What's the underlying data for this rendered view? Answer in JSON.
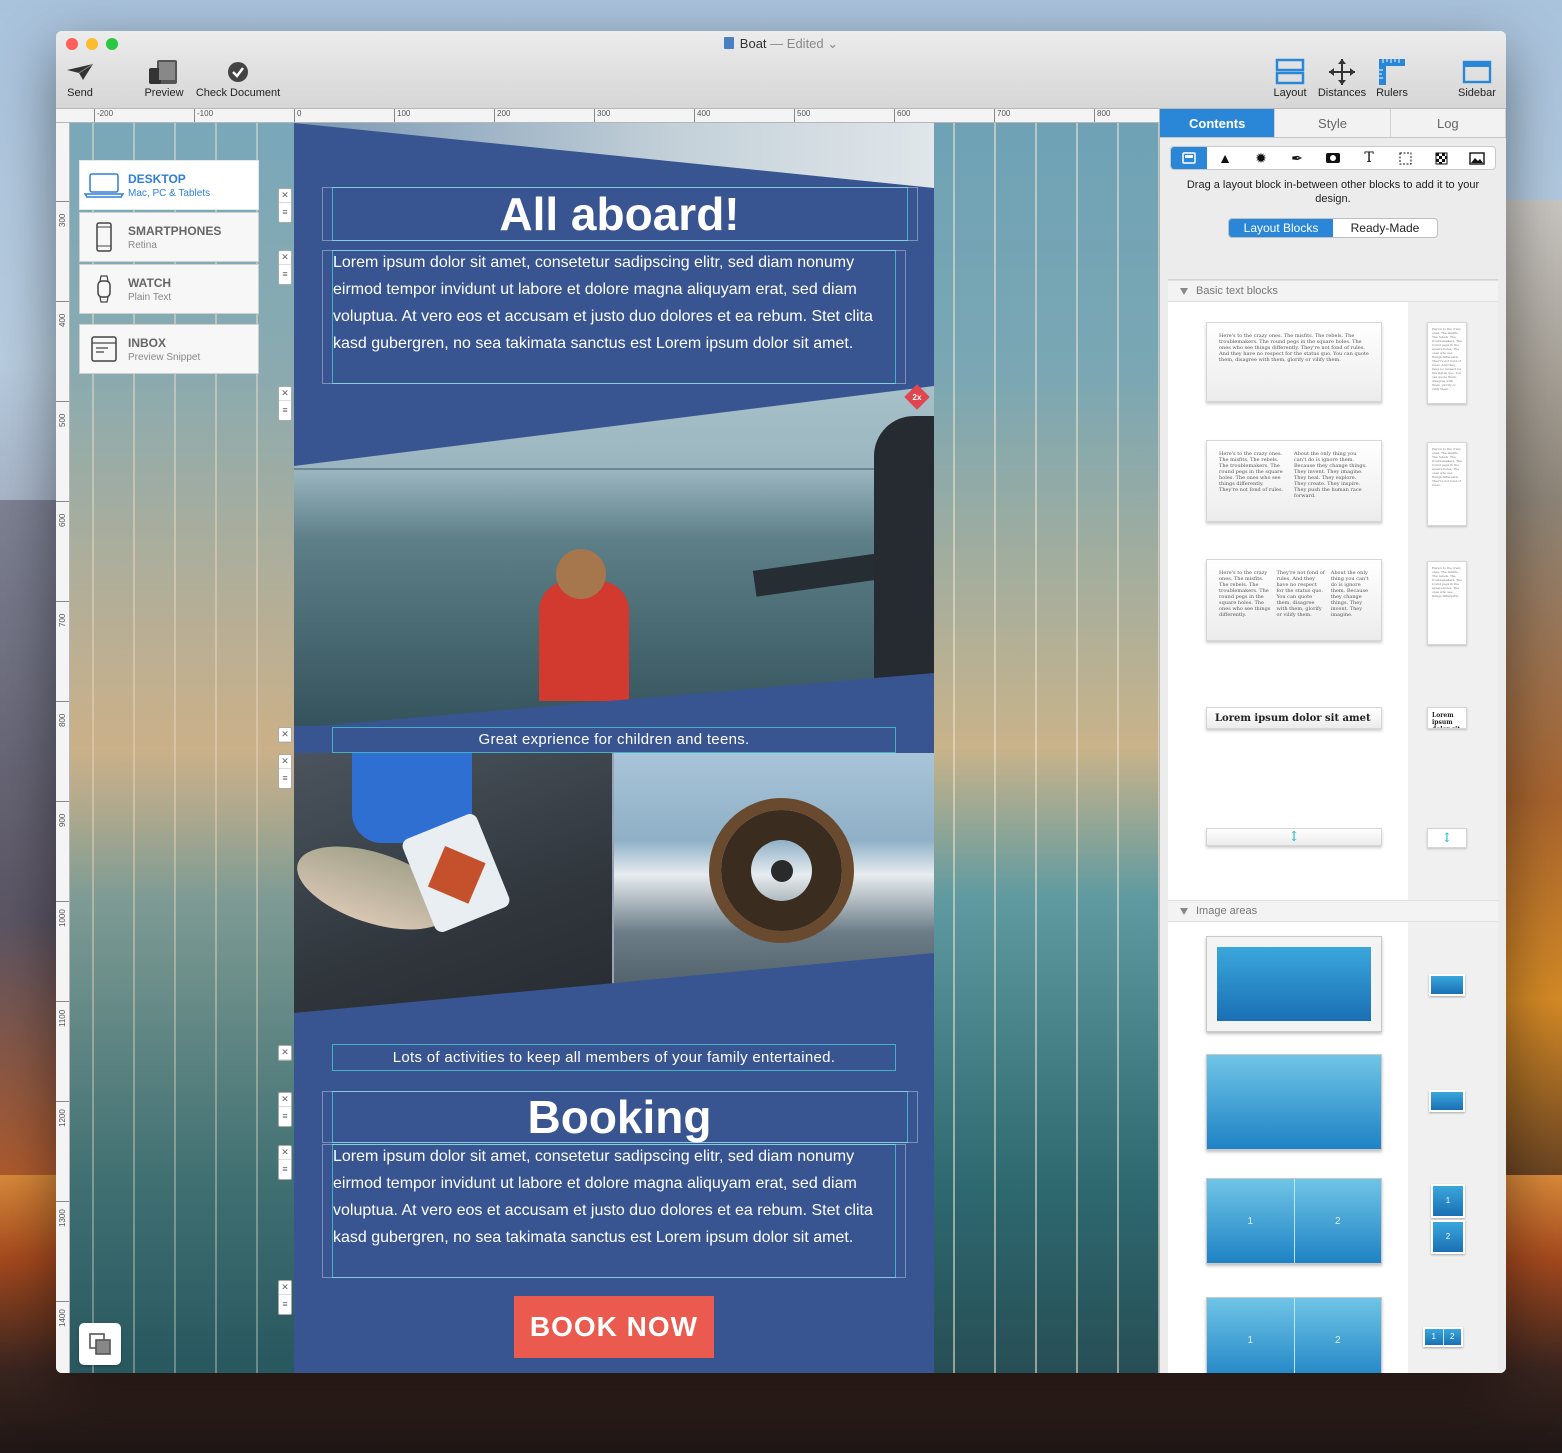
{
  "window": {
    "title": "Boat",
    "title_suffix": "— Edited",
    "title_chevron": "⌄",
    "traffic_lights": {
      "close": "#fc5f57",
      "minimize": "#fdbc2e",
      "zoom": "#28c840"
    }
  },
  "toolbar": {
    "send": "Send",
    "preview": "Preview",
    "check_document": "Check Document",
    "layout": "Layout",
    "distances": "Distances",
    "rulers": "Rulers",
    "sidebar": "Sidebar"
  },
  "rulers": {
    "horizontal": [
      "-200",
      "-100",
      "0",
      "100",
      "200",
      "300",
      "400",
      "500",
      "600",
      "700",
      "800"
    ],
    "vertical": [
      "300",
      "400",
      "500",
      "600",
      "700",
      "800",
      "900",
      "1000",
      "1100",
      "1200",
      "1300",
      "1400"
    ]
  },
  "devices": [
    {
      "name": "DESKTOP",
      "sub": "Mac, PC & Tablets",
      "icon": "laptop-icon",
      "active": true
    },
    {
      "name": "SMARTPHONES",
      "sub": "Retina",
      "icon": "phone-icon",
      "active": false
    },
    {
      "name": "WATCH",
      "sub": "Plain Text",
      "icon": "watch-icon",
      "active": false
    },
    {
      "name": "INBOX",
      "sub": "Preview Snippet",
      "icon": "inbox-icon",
      "active": false
    }
  ],
  "email": {
    "heading1": "All aboard!",
    "paragraph1": "Lorem ipsum dolor sit amet, consetetur sadipscing elitr, sed diam nonumy eirmod tempor invidunt ut labore et dolore magna aliquyam erat, sed diam voluptua. At vero eos et accusam et justo duo dolores et ea rebum. Stet clita kasd gubergren, no sea takimata sanctus est Lorem ipsum dolor sit amet.",
    "retina_badge": "2x",
    "caption1": "Great exprience for children and teens.",
    "caption2": "Lots of activities to keep all members of your family entertained.",
    "heading2": "Booking",
    "paragraph2": "Lorem ipsum dolor sit amet, consetetur sadipscing elitr, sed diam nonumy eirmod tempor invidunt ut labore et dolore magna aliquyam erat, sed diam voluptua. At vero eos et accusam et justo duo dolores et ea rebum. Stet clita kasd gubergren, no sea takimata sanctus est Lorem ipsum dolor sit amet.",
    "cta": "BOOK NOW",
    "colors": {
      "background": "#385592",
      "cta": "#ea5a4f"
    }
  },
  "sidebar": {
    "tabs": [
      "Contents",
      "Style",
      "Log"
    ],
    "active_tab": "Contents",
    "tools": [
      "layout-block-icon",
      "shape-icon",
      "badge-icon",
      "pen-icon",
      "video-icon",
      "text-icon",
      "selection-icon",
      "pattern-icon",
      "image-icon"
    ],
    "hint": "Drag a layout block in-between other blocks to add it to your design.",
    "segments": [
      "Layout Blocks",
      "Ready-Made"
    ],
    "active_segment": "Layout Blocks",
    "section_basic": "Basic text blocks",
    "section_images": "Image areas",
    "thumb_text_1": "Here's to the crazy ones. The misfits. The rebels. The troublemakers. The round pegs in the square holes. The ones who see things differently. They're not fond of rules. And they have no respect for the status quo. You can quote them, disagree with them, glorify or vilify them.",
    "thumb_text_2a": "Here's to the crazy ones. The misfits. The rebels. The troublemakers. The round pegs in the square holes. The ones who see things differently. They're not fond of rules.",
    "thumb_text_2b": "About the only thing you can't do is ignore them. Because they change things. They invent. They imagine. They heal. They explore. They create. They inspire. They push the human race forward.",
    "thumb_text_3a": "Here's to the crazy ones. The misfits. The rebels. The troublemakers. The round pegs in the square holes. The ones who see things differently.",
    "thumb_text_3b": "They're not fond of rules. And they have no respect for the status quo. You can quote them, disagree with them, glorify or vilify them.",
    "thumb_text_3c": "About the only thing you can't do is ignore them. Because they change things. They invent. They imagine.",
    "thumb_lorem": "Lorem ipsum dolor sit amet",
    "thumb_lorem_small": "Lorem ipsum dolor sit amet",
    "spacer_icon": "↕",
    "image_labels": [
      "1",
      "2"
    ]
  }
}
